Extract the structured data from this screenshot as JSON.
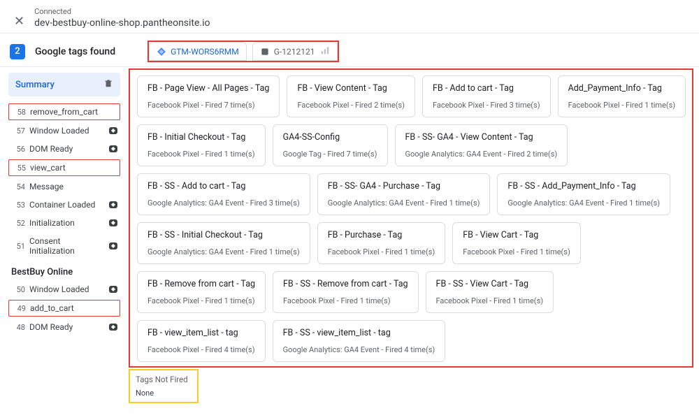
{
  "header": {
    "close_glyph": "✕",
    "connected_label": "Connected",
    "site_url": "dev-bestbuy-online-shop.pantheonsite.io"
  },
  "titlebar": {
    "count": "2",
    "title": "Google tags found",
    "gtm_label": "GTM-WORS6RMM",
    "ga_label": "G-1212121"
  },
  "sidebar": {
    "summary_label": "Summary",
    "groups": [
      {
        "events": [
          {
            "num": "58",
            "label": "remove_from_cart",
            "badge": false,
            "red": true
          },
          {
            "num": "57",
            "label": "Window Loaded",
            "badge": true,
            "red": false
          },
          {
            "num": "56",
            "label": "DOM Ready",
            "badge": true,
            "red": false
          },
          {
            "num": "55",
            "label": "view_cart",
            "badge": false,
            "red": true
          },
          {
            "num": "54",
            "label": "Message",
            "badge": false,
            "red": false
          },
          {
            "num": "53",
            "label": "Container Loaded",
            "badge": true,
            "red": false
          },
          {
            "num": "52",
            "label": "Initialization",
            "badge": true,
            "red": false
          },
          {
            "num": "51",
            "label": "Consent Initialization",
            "badge": true,
            "red": false
          }
        ]
      },
      {
        "workspace_title": "BestBuy Online",
        "events": [
          {
            "num": "50",
            "label": "Window Loaded",
            "badge": true,
            "red": false
          },
          {
            "num": "49",
            "label": "add_to_cart",
            "badge": false,
            "red": true
          },
          {
            "num": "48",
            "label": "DOM Ready",
            "badge": true,
            "red": false
          }
        ]
      }
    ]
  },
  "fired": [
    {
      "title": "FB - Page View - All Pages - Tag",
      "sub": "Facebook Pixel - Fired 7 time(s)"
    },
    {
      "title": "FB - View Content - Tag",
      "sub": "Facebook Pixel - Fired 2 time(s)"
    },
    {
      "title": "FB - Add to cart - Tag",
      "sub": "Facebook Pixel - Fired 3 time(s)"
    },
    {
      "title": "Add_Payment_Info - Tag",
      "sub": "Facebook Pixel - Fired 1 time(s)"
    },
    {
      "title": "FB - Initial Checkout - Tag",
      "sub": "Facebook Pixel - Fired 1 time(s)"
    },
    {
      "title": "GA4-SS-Config",
      "sub": "Google Tag - Fired 7 time(s)"
    },
    {
      "title": "FB - SS- GA4 - View Content - Tag",
      "sub": "Google Analytics: GA4 Event - Fired 2 time(s)"
    },
    {
      "title": "FB - SS - Add to cart - Tag",
      "sub": "Google Analytics: GA4 Event - Fired 3 time(s)"
    },
    {
      "title": "FB - SS- GA4 - Purchase - Tag",
      "sub": "Google Analytics: GA4 Event - Fired 1 time(s)"
    },
    {
      "title": "FB - SS - Add_Payment_Info - Tag",
      "sub": "Google Analytics: GA4 Event - Fired 1 time(s)"
    },
    {
      "title": "FB - SS - Initial Checkout - Tag",
      "sub": "Google Analytics: GA4 Event - Fired 1 time(s)"
    },
    {
      "title": "FB - Purchase - Tag",
      "sub": "Facebook Pixel - Fired 1 time(s)"
    },
    {
      "title": "FB - View Cart - Tag",
      "sub": "Facebook Pixel - Fired 1 time(s)"
    },
    {
      "title": "FB - Remove from cart - Tag",
      "sub": "Facebook Pixel - Fired 1 time(s)"
    },
    {
      "title": "FB - SS - Remove from cart - Tag",
      "sub": "Facebook Pixel - Fired 1 time(s)"
    },
    {
      "title": "FB - SS - View Cart - Tag",
      "sub": "Facebook Pixel - Fired 1 time(s)"
    },
    {
      "title": "FB - view_item_list - tag",
      "sub": "Facebook Pixel - Fired 4 time(s)"
    },
    {
      "title": "FB - SS - view_item_list - tag",
      "sub": "Google Analytics: GA4 Event - Fired 4 time(s)"
    }
  ],
  "not_fired": {
    "title": "Tags Not Fired",
    "value": "None"
  }
}
